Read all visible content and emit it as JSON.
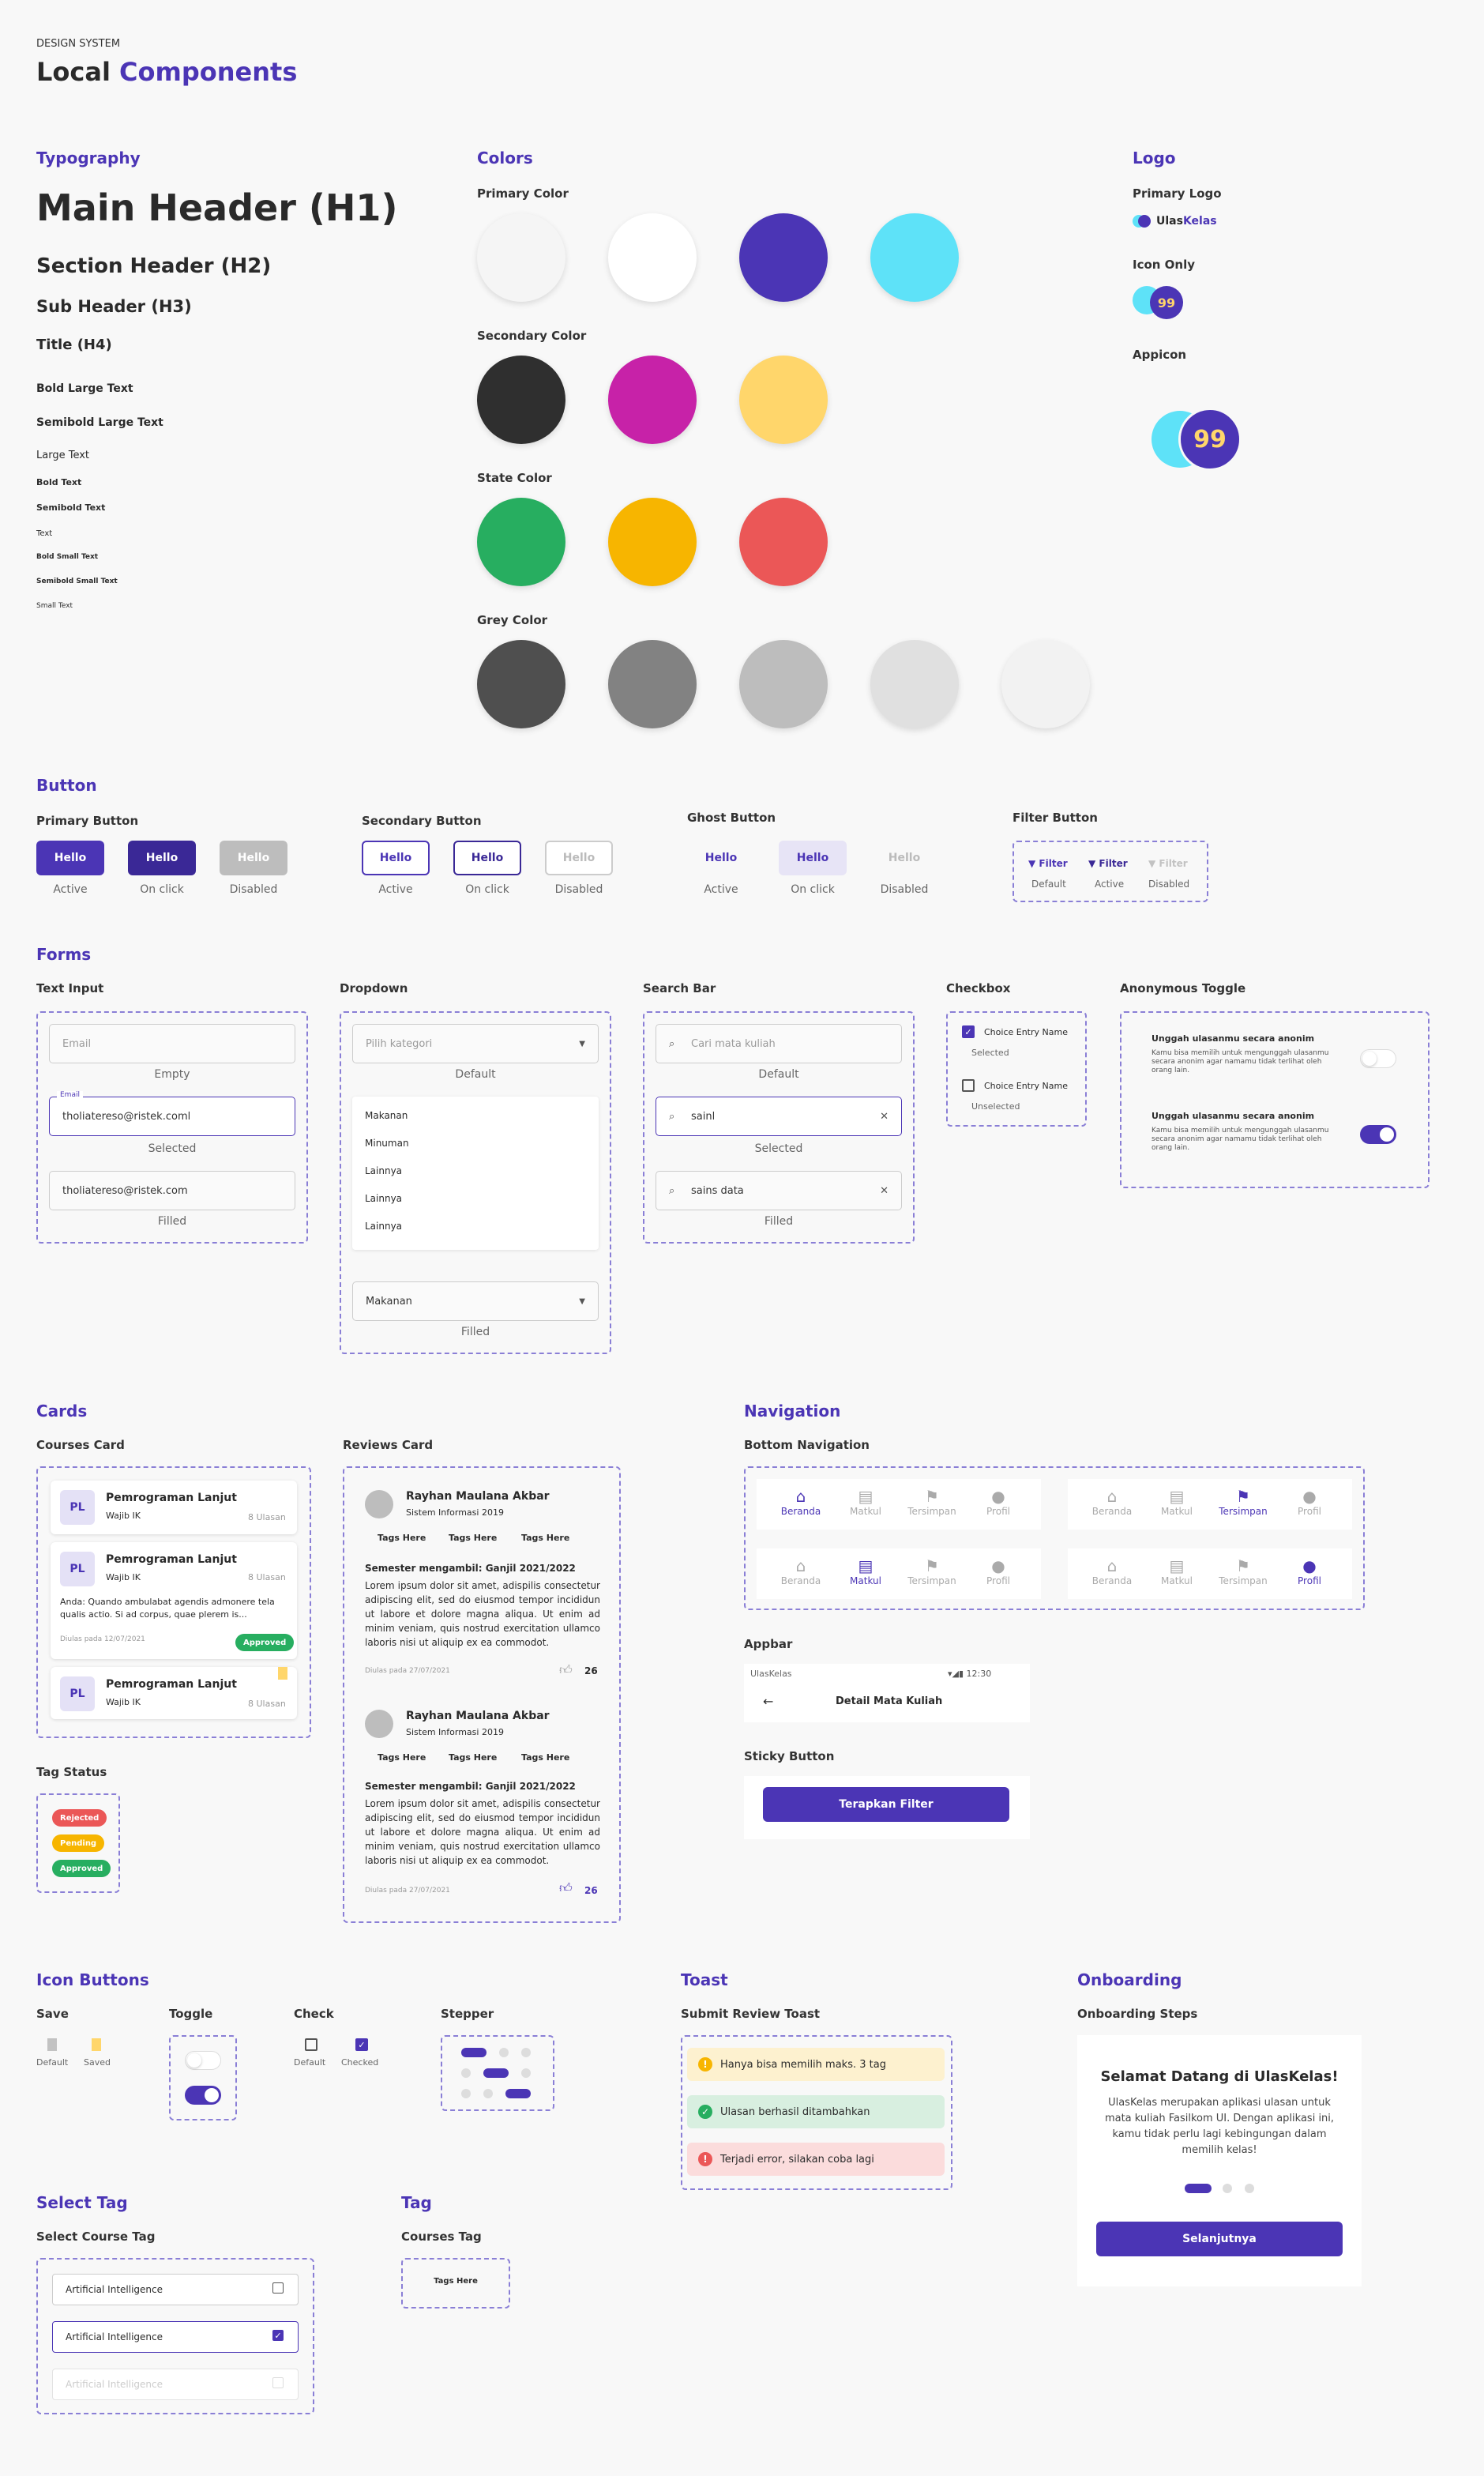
{
  "header": {
    "kicker": "DESIGN SYSTEM",
    "title_a": "Local",
    "title_b": "Components"
  },
  "typography": {
    "title": "Typography",
    "h1": "Main Header (H1)",
    "h2": "Section Header (H2)",
    "h3": "Sub Header (H3)",
    "h4": "Title (H4)",
    "items": [
      "Bold Large Text",
      "Semibold Large Text",
      "Large Text",
      "Bold Text",
      "Semibold Text",
      "Text",
      "Bold Small Text",
      "Semibold Small Text",
      "Small Text"
    ]
  },
  "colors": {
    "title": "Colors",
    "groups": [
      {
        "label": "Primary Color",
        "swatches": [
          "#f5f5f5",
          "#ffffff",
          "#4b35b5",
          "#5ee2f8"
        ]
      },
      {
        "label": "Secondary Color",
        "swatches": [
          "#2f2f2f",
          "#c722a8",
          "#ffd66b"
        ]
      },
      {
        "label": "State Color",
        "swatches": [
          "#27ae60",
          "#f7b500",
          "#eb5757"
        ]
      },
      {
        "label": "Grey Color",
        "swatches": [
          "#4f4f4f",
          "#828282",
          "#bdbdbd",
          "#e0e0e0",
          "#f2f2f2"
        ]
      }
    ]
  },
  "logo": {
    "title": "Logo",
    "primary": "Primary Logo",
    "brand_a": "Ulas",
    "brand_b": "Kelas",
    "icon_only": "Icon Only",
    "appicon": "Appicon",
    "quote": "99"
  },
  "button": {
    "title": "Button",
    "primary": "Primary Button",
    "secondary": "Secondary Button",
    "ghost": "Ghost Button",
    "filter": "Filter Button",
    "hello": "Hello",
    "active": "Active",
    "onclick": "On click",
    "disabled": "Disabled",
    "filter_label": "Filter",
    "default": "Default"
  },
  "forms": {
    "title": "Forms",
    "text_input": "Text Input",
    "dropdown": "Dropdown",
    "search": "Search Bar",
    "checkbox": "Checkbox",
    "anon": "Anonymous Toggle",
    "email_ph": "Email",
    "email_label": "Email",
    "email_val": "tholiatereso@ristek.coml",
    "email_filled": "tholiatereso@ristek.com",
    "empty": "Empty",
    "selected": "Selected",
    "filled": "Filled",
    "default": "Default",
    "dd_ph": "Pilih kategori",
    "dd_options": [
      "Makanan",
      "Minuman",
      "Lainnya",
      "Lainnya",
      "Lainnya"
    ],
    "dd_filled": "Makanan",
    "search_ph": "Cari mata kuliah",
    "search_sel": "sainl",
    "search_filled": "sains data",
    "choice": "Choice Entry Name",
    "cb_selected": "Selected",
    "cb_unselected": "Unselected",
    "anon_title": "Unggah ulasanmu secara anonim",
    "anon_desc": "Kamu bisa memilih untuk mengunggah ulasanmu secara anonim agar namamu tidak terlihat oleh orang lain."
  },
  "cards": {
    "title": "Cards",
    "courses": "Courses Card",
    "reviews": "Reviews Card",
    "tagstatus": "Tag Status",
    "pl": "PL",
    "course": "Pemrograman Lanjut",
    "wajib": "Wajib IK",
    "ulasan": "8 Ulasan",
    "anda": "Anda: Quando ambulabat agendis admonere tela qualis actio. Si ad corpus, quae plerem is...",
    "diulas": "Diulas pada 12/07/2021",
    "approved": "Approved",
    "rejected": "Rejected",
    "pending": "Pending",
    "reviewer": "Rayhan Maulana Akbar",
    "prodi": "Sistem Informasi 2019",
    "tags": [
      "Tags Here",
      "Tags Here",
      "Tags Here"
    ],
    "semester": "Semester mengambil: Ganjil 2021/2022",
    "lorem": "Lorem ipsum dolor sit amet, adispilis consectetur adipiscing elit, sed do eiusmod tempor incididun ut labore et dolore magna aliqua. Ut enim ad minim veniam, quis nostrud exercitation ullamco laboris nisi ut aliquip ex ea commodot.",
    "review_date": "Diulas pada 27/07/2021",
    "likes": "26"
  },
  "navigation": {
    "title": "Navigation",
    "bottom": "Bottom Navigation",
    "items": [
      "Beranda",
      "Matkul",
      "Tersimpan",
      "Profil"
    ],
    "appbar": "Appbar",
    "app_name": "UlasKelas",
    "time": "12:30",
    "appbar_title": "Detail Mata Kuliah",
    "sticky": "Sticky Button",
    "sticky_label": "Terapkan Filter"
  },
  "icon_buttons": {
    "title": "Icon Buttons",
    "save": "Save",
    "toggle": "Toggle",
    "check": "Check",
    "stepper": "Stepper",
    "default": "Default",
    "saved": "Saved",
    "checked": "Checked"
  },
  "toast": {
    "title": "Toast",
    "sub": "Submit Review Toast",
    "warn": "Hanya bisa memilih maks. 3 tag",
    "ok": "Ulasan berhasil ditambahkan",
    "err": "Terjadi error, silakan coba lagi",
    "warn_color": "#fdf1cf",
    "ok_color": "#d8efe0",
    "err_color": "#fbdcdc"
  },
  "onboarding": {
    "title": "Onboarding",
    "sub": "Onboarding Steps",
    "heading": "Selamat Datang di UlasKelas!",
    "body": "UlasKelas merupakan aplikasi ulasan untuk mata kuliah Fasilkom UI. Dengan aplikasi ini, kamu tidak perlu lagi kebingungan dalam memilih kelas!",
    "cta": "Selanjutnya"
  },
  "select_tag": {
    "title": "Select Tag",
    "sub": "Select Course Tag",
    "item": "Artificial Intelligence"
  },
  "tag": {
    "title": "Tag",
    "sub": "Courses Tag",
    "item": "Tags Here"
  },
  "accent": "#4b35b5"
}
